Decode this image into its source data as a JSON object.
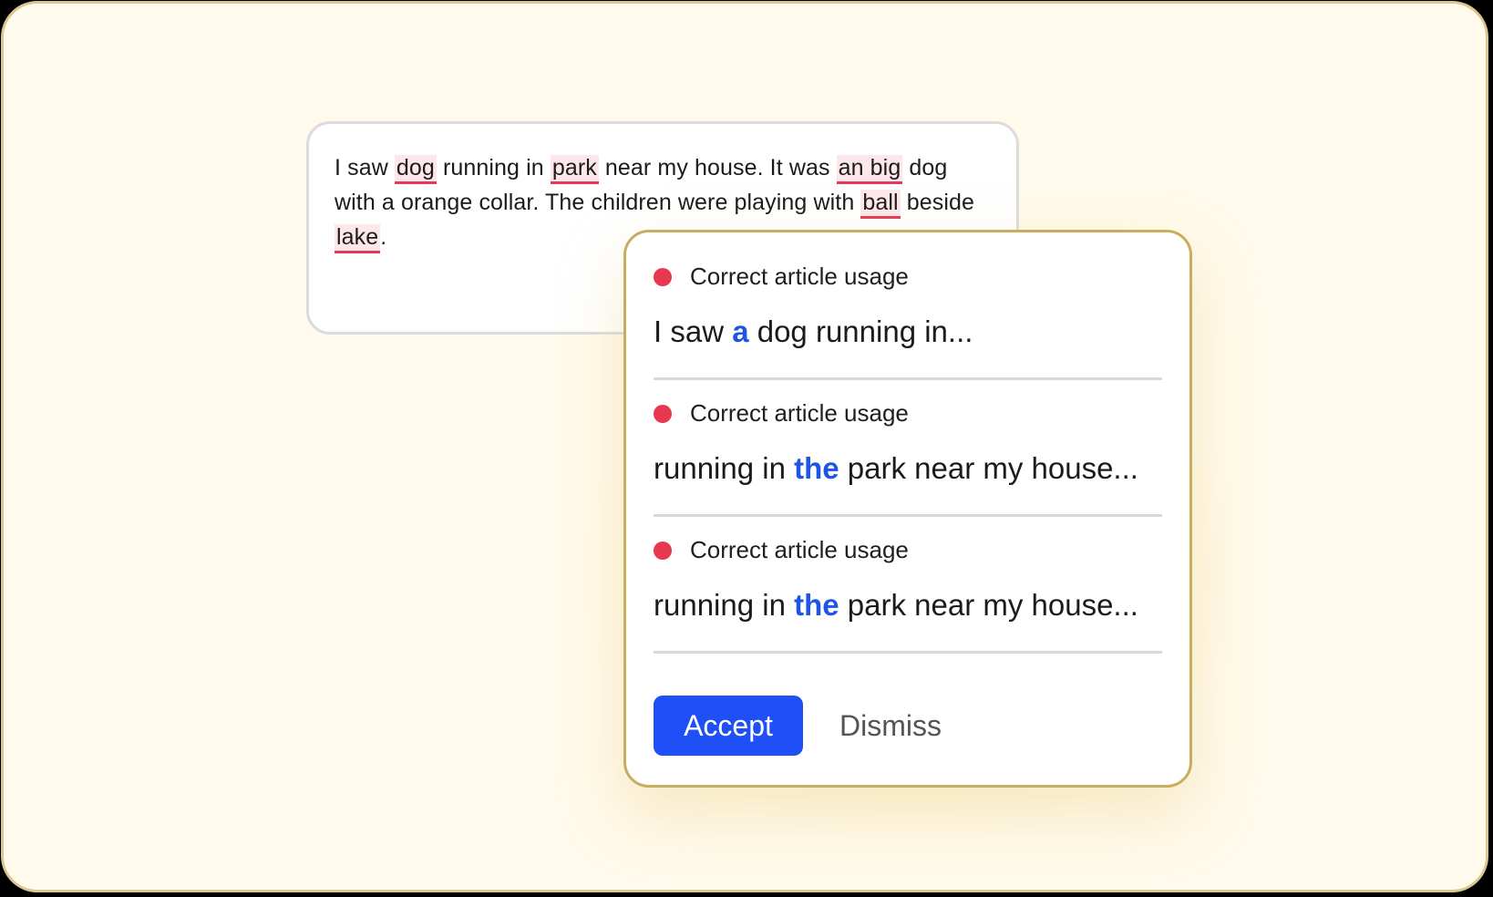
{
  "editor": {
    "segments": [
      {
        "text": "I saw ",
        "error": false
      },
      {
        "text": "dog",
        "error": true
      },
      {
        "text": " running in ",
        "error": false
      },
      {
        "text": "park",
        "error": true
      },
      {
        "text": " near my house. It was ",
        "error": false
      },
      {
        "text": "an big",
        "error": true
      },
      {
        "text": " dog with a orange collar. The children were playing with ",
        "error": false
      },
      {
        "text": "ball",
        "error": true
      },
      {
        "text": " beside ",
        "error": false
      },
      {
        "text": "lake",
        "error": true
      },
      {
        "text": ".",
        "error": false
      }
    ]
  },
  "suggestions": [
    {
      "label": "Correct article usage",
      "before": "I saw ",
      "highlight": "a",
      "after": " dog running in..."
    },
    {
      "label": "Correct article usage",
      "before": "running in ",
      "highlight": "the",
      "after": " park near my house..."
    },
    {
      "label": "Correct article usage",
      "before": "running in ",
      "highlight": "the",
      "after": " park near my house..."
    }
  ],
  "actions": {
    "accept_label": "Accept",
    "dismiss_label": "Dismiss"
  },
  "colors": {
    "accent": "#1f4ff6",
    "highlight": "#1e55e6",
    "error": "#e8384f",
    "popup_border": "#c9ad5e"
  },
  "icons": {
    "suggestion_marker": "red-dot-icon"
  }
}
